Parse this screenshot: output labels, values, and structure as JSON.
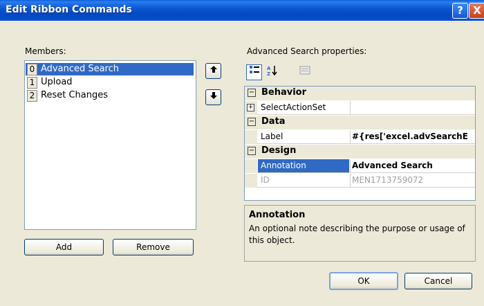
{
  "window": {
    "title": "Edit Ribbon Commands",
    "help_glyph": "?",
    "close_glyph": "X"
  },
  "members": {
    "label": "Members:",
    "items": [
      {
        "index": "0",
        "label": "Advanced Search",
        "selected": true
      },
      {
        "index": "1",
        "label": "Upload",
        "selected": false
      },
      {
        "index": "2",
        "label": "Reset Changes",
        "selected": false
      }
    ],
    "add_label": "Add",
    "remove_label": "Remove",
    "move_up_icon": "arrow-up-icon",
    "move_down_icon": "arrow-down-icon"
  },
  "properties": {
    "label": "Advanced Search properties:",
    "toolbar": [
      "categorized-icon",
      "alphabetical-icon",
      "property-pages-icon"
    ],
    "categories": [
      {
        "name": "Behavior",
        "rows": [
          {
            "name": "SelectActionSet",
            "value": "",
            "expandable": true
          }
        ]
      },
      {
        "name": "Data",
        "rows": [
          {
            "name": "Label",
            "value": "#{res['excel.advSearchE",
            "bold": true
          }
        ]
      },
      {
        "name": "Design",
        "rows": [
          {
            "name": "Annotation",
            "value": "Advanced Search",
            "bold": true,
            "selected": true
          },
          {
            "name": "ID",
            "value": "MEN1713759072",
            "disabled": true
          }
        ]
      }
    ]
  },
  "description": {
    "title": "Annotation",
    "text": "An optional note describing the purpose or usage of this object."
  },
  "buttons": {
    "ok_label": "OK",
    "cancel_label": "Cancel"
  }
}
